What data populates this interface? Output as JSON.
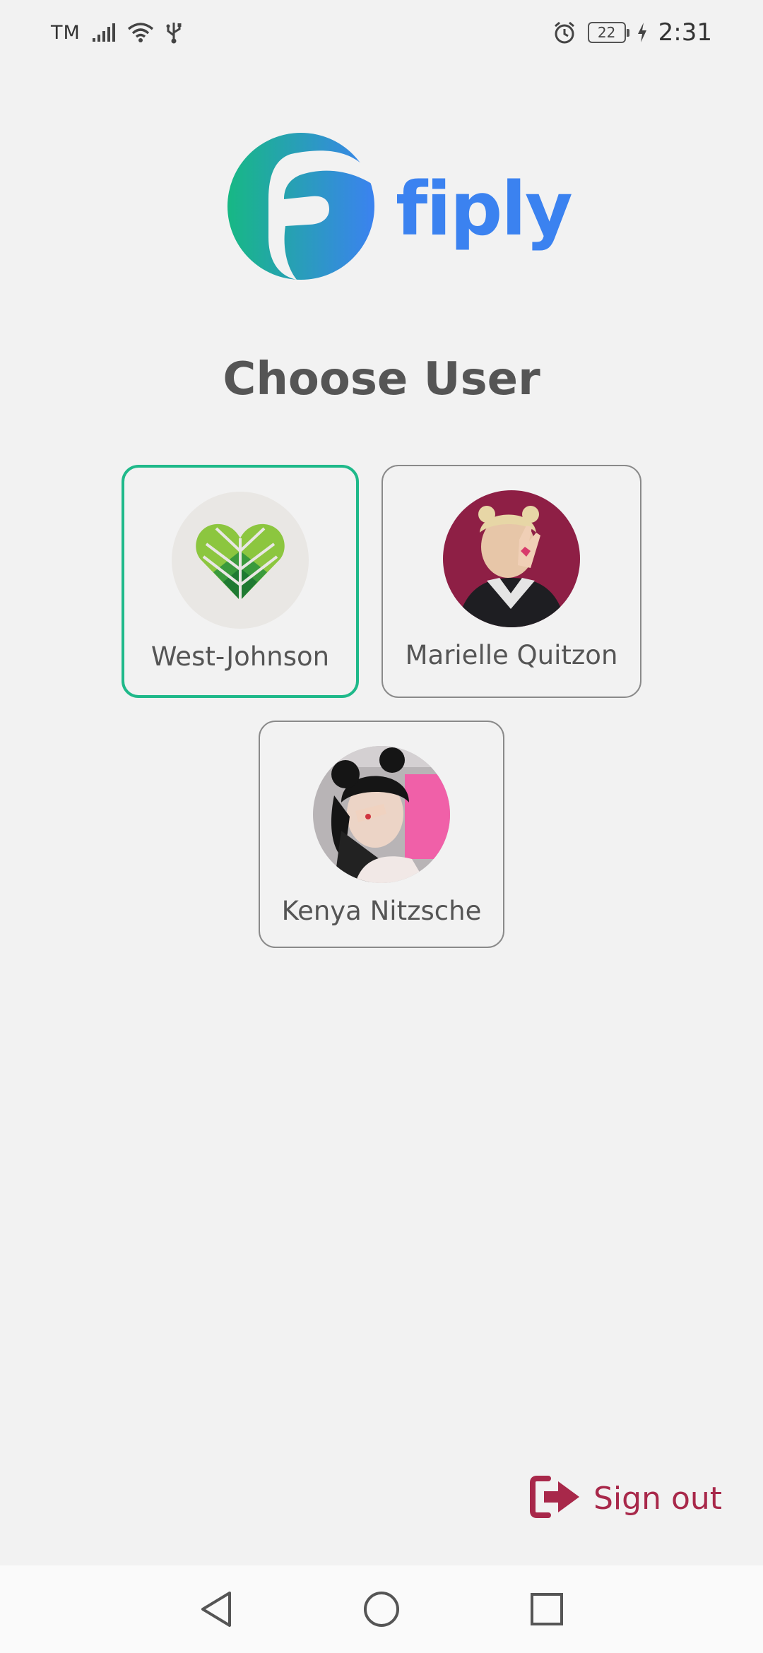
{
  "status_bar": {
    "carrier": "TM",
    "battery_level": "22",
    "time": "2:31",
    "icons": [
      "signal-icon",
      "wifi-icon",
      "usb-icon",
      "alarm-icon",
      "battery-icon",
      "charging-icon"
    ]
  },
  "logo": {
    "wordmark": "fiply",
    "colors": {
      "gradient_start": "#17b884",
      "gradient_end": "#3b82f0",
      "wordmark": "#3b82f0"
    }
  },
  "page": {
    "title": "Choose User"
  },
  "users": [
    {
      "name": "West-Johnson",
      "selected": true,
      "avatar": "green-heart-logo"
    },
    {
      "name": "Marielle Quitzon",
      "selected": false,
      "avatar": "user-photo"
    },
    {
      "name": "Kenya Nitzsche",
      "selected": false,
      "avatar": "user-photo"
    }
  ],
  "actions": {
    "sign_out_label": "Sign out",
    "sign_out_icon": "sign-out-icon"
  },
  "nav_bar": {
    "buttons": [
      "back-icon",
      "home-icon",
      "recents-icon"
    ]
  },
  "colors": {
    "selected_border": "#1fb98a",
    "sign_out": "#a8284a",
    "background": "#f2f2f2"
  }
}
